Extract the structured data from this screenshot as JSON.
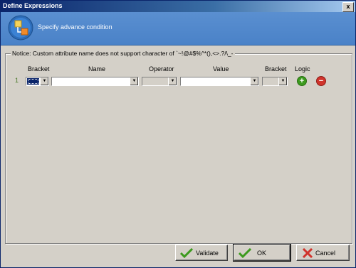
{
  "window": {
    "title": "Define Expressions",
    "close_label": "x"
  },
  "banner": {
    "text": "Specify advance condition",
    "icon": "expression-icon"
  },
  "group": {
    "notice": "Notice: Custom attribute name does not support character of `~!@#$%^*(),<>.?/\\_-"
  },
  "columns": [
    "Bracket",
    "Name",
    "Operator",
    "Value",
    "Bracket",
    "Logic"
  ],
  "rows": [
    {
      "index": "1",
      "open_bracket": "",
      "name": "",
      "operator": "",
      "value": "",
      "close_bracket": ""
    }
  ],
  "row_actions": {
    "add_icon": "add-icon",
    "remove_icon": "remove-icon",
    "add_symbol": "+",
    "remove_symbol": "−"
  },
  "buttons": {
    "validate": "Validate",
    "ok": "OK",
    "cancel": "Cancel"
  },
  "colors": {
    "banner": "#4a82c8",
    "add": "#3c9a1e",
    "remove": "#d0342c"
  }
}
